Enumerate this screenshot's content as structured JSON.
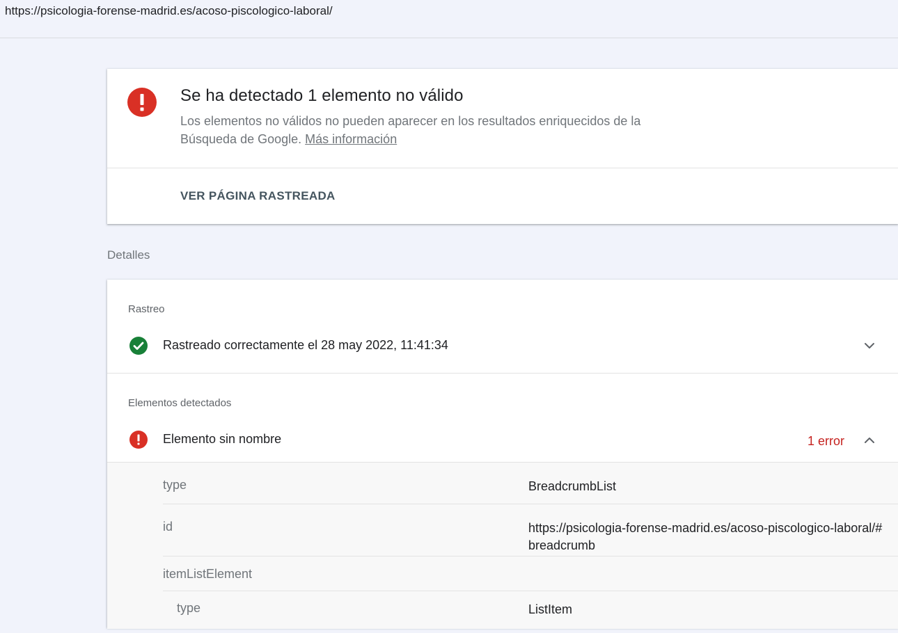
{
  "url_bar": {
    "url": "https://psicologia-forense-madrid.es/acoso-piscologico-laboral/"
  },
  "summary": {
    "title": "Se ha detectado 1 elemento no válido",
    "description": "Los elementos no válidos no pueden aparecer en los resultados enriquecidos de la Búsqueda de Google.",
    "more_info_link": "Más información",
    "view_page_button": "VER PÁGINA RASTREADA",
    "icon": "error-icon"
  },
  "details": {
    "heading": "Detalles",
    "crawl": {
      "label": "Rastreo",
      "status_text": "Rastreado correctamente el 28 may 2022, 11:41:34",
      "icon": "check-circle-icon",
      "expanded": false
    },
    "detected": {
      "label": "Elementos detectados",
      "item_name": "Elemento sin nombre",
      "error_count": "1 error",
      "icon": "error-icon",
      "expanded": true
    },
    "properties": [
      {
        "key": "type",
        "value": "BreadcrumbList"
      },
      {
        "key": "id",
        "value": "https://psicologia-forense-madrid.es/acoso-piscologico-laboral/#breadcrumb"
      },
      {
        "key": "itemListElement",
        "value": ""
      },
      {
        "key": "type",
        "value": "ListItem"
      }
    ]
  },
  "colors": {
    "error_red": "#d93025",
    "success_green": "#188038",
    "error_text": "#c5221f",
    "page_background": "#f1f3fb"
  }
}
